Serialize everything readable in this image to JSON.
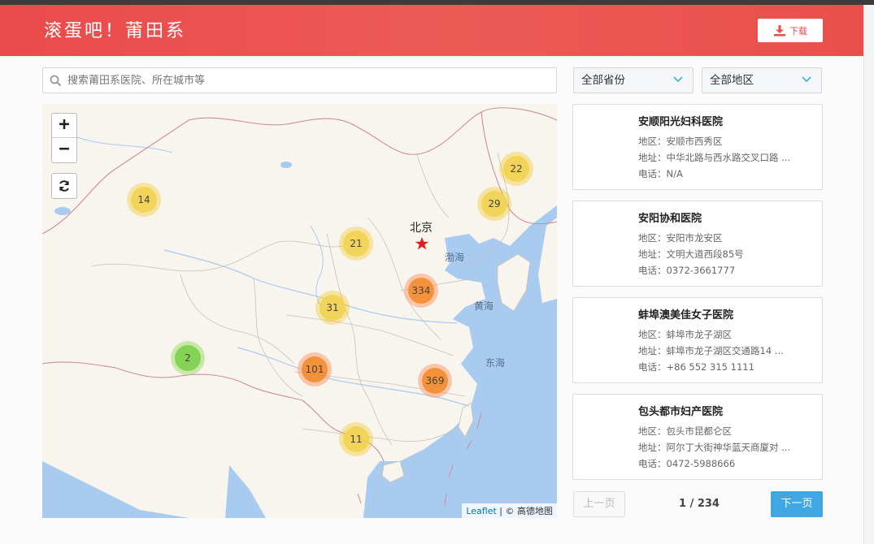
{
  "header": {
    "brand": "滚蛋吧！莆田系",
    "download_label": "下载"
  },
  "search": {
    "placeholder": "搜索莆田系医院、所在城市等"
  },
  "filters": {
    "province": "全部省份",
    "area": "全部地区"
  },
  "map": {
    "zoom_in": "+",
    "zoom_out": "−",
    "capital_label": "北京",
    "sea_labels": [
      "渤海",
      "黄海",
      "东海"
    ],
    "attribution_link": "Leaflet",
    "attribution_text": " | © 高德地图",
    "clusters": [
      {
        "count": "14",
        "level": "yellow"
      },
      {
        "count": "22",
        "level": "yellow"
      },
      {
        "count": "29",
        "level": "yellow"
      },
      {
        "count": "21",
        "level": "yellow"
      },
      {
        "count": "334",
        "level": "orange"
      },
      {
        "count": "31",
        "level": "yellow"
      },
      {
        "count": "2",
        "level": "green"
      },
      {
        "count": "101",
        "level": "orange"
      },
      {
        "count": "369",
        "level": "orange"
      },
      {
        "count": "11",
        "level": "yellow"
      }
    ]
  },
  "hospitals": [
    {
      "name": "安顺阳光妇科医院",
      "region_key": "地区：",
      "region": "安顺市西秀区",
      "address_key": "地址：",
      "address": "中华北路与西水路交叉口路 ...",
      "phone_key": "电话：",
      "phone": "N/A"
    },
    {
      "name": "安阳协和医院",
      "region_key": "地区：",
      "region": "安阳市龙安区",
      "address_key": "地址：",
      "address": "文明大道西段85号",
      "phone_key": "电话：",
      "phone": "0372-3661777"
    },
    {
      "name": "蚌埠澳美佳女子医院",
      "region_key": "地区：",
      "region": "蚌埠市龙子湖区",
      "address_key": "地址：",
      "address": "蚌埠市龙子湖区交通路14 ...",
      "phone_key": "电话：",
      "phone": "+86 552 315 1111"
    },
    {
      "name": "包头都市妇产医院",
      "region_key": "地区：",
      "region": "包头市昆都仑区",
      "address_key": "地址：",
      "address": "阿尔丁大街神华蓝天商厦对 ...",
      "phone_key": "电话：",
      "phone": "0472-5988666"
    }
  ],
  "pager": {
    "prev": "上一页",
    "info": "1 / 234",
    "next": "下一页"
  },
  "colors": {
    "header": "#e94b4b",
    "next_button": "#3fa7e1",
    "water": "#a9cbf0",
    "land": "#f8f5ee"
  }
}
